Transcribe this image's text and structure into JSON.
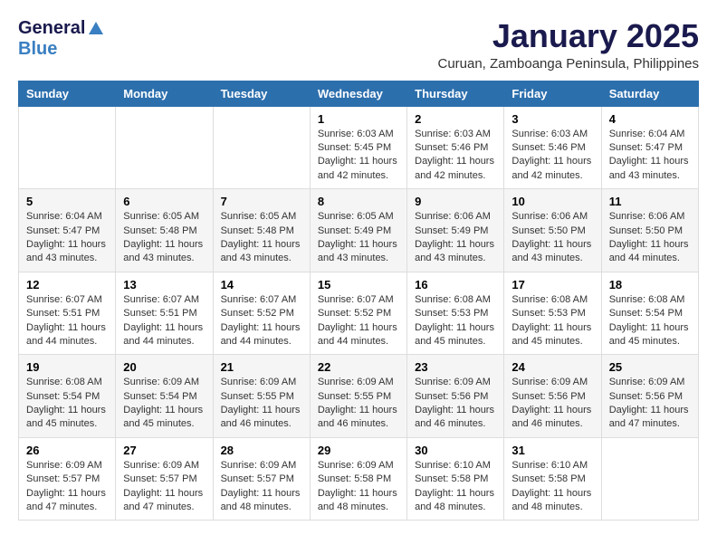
{
  "logo": {
    "general": "General",
    "blue": "Blue"
  },
  "title": "January 2025",
  "location": "Curuan, Zamboanga Peninsula, Philippines",
  "weekdays": [
    "Sunday",
    "Monday",
    "Tuesday",
    "Wednesday",
    "Thursday",
    "Friday",
    "Saturday"
  ],
  "weeks": [
    [
      {
        "day": "",
        "info": ""
      },
      {
        "day": "",
        "info": ""
      },
      {
        "day": "",
        "info": ""
      },
      {
        "day": "1",
        "info": "Sunrise: 6:03 AM\nSunset: 5:45 PM\nDaylight: 11 hours and 42 minutes."
      },
      {
        "day": "2",
        "info": "Sunrise: 6:03 AM\nSunset: 5:46 PM\nDaylight: 11 hours and 42 minutes."
      },
      {
        "day": "3",
        "info": "Sunrise: 6:03 AM\nSunset: 5:46 PM\nDaylight: 11 hours and 42 minutes."
      },
      {
        "day": "4",
        "info": "Sunrise: 6:04 AM\nSunset: 5:47 PM\nDaylight: 11 hours and 43 minutes."
      }
    ],
    [
      {
        "day": "5",
        "info": "Sunrise: 6:04 AM\nSunset: 5:47 PM\nDaylight: 11 hours and 43 minutes."
      },
      {
        "day": "6",
        "info": "Sunrise: 6:05 AM\nSunset: 5:48 PM\nDaylight: 11 hours and 43 minutes."
      },
      {
        "day": "7",
        "info": "Sunrise: 6:05 AM\nSunset: 5:48 PM\nDaylight: 11 hours and 43 minutes."
      },
      {
        "day": "8",
        "info": "Sunrise: 6:05 AM\nSunset: 5:49 PM\nDaylight: 11 hours and 43 minutes."
      },
      {
        "day": "9",
        "info": "Sunrise: 6:06 AM\nSunset: 5:49 PM\nDaylight: 11 hours and 43 minutes."
      },
      {
        "day": "10",
        "info": "Sunrise: 6:06 AM\nSunset: 5:50 PM\nDaylight: 11 hours and 43 minutes."
      },
      {
        "day": "11",
        "info": "Sunrise: 6:06 AM\nSunset: 5:50 PM\nDaylight: 11 hours and 44 minutes."
      }
    ],
    [
      {
        "day": "12",
        "info": "Sunrise: 6:07 AM\nSunset: 5:51 PM\nDaylight: 11 hours and 44 minutes."
      },
      {
        "day": "13",
        "info": "Sunrise: 6:07 AM\nSunset: 5:51 PM\nDaylight: 11 hours and 44 minutes."
      },
      {
        "day": "14",
        "info": "Sunrise: 6:07 AM\nSunset: 5:52 PM\nDaylight: 11 hours and 44 minutes."
      },
      {
        "day": "15",
        "info": "Sunrise: 6:07 AM\nSunset: 5:52 PM\nDaylight: 11 hours and 44 minutes."
      },
      {
        "day": "16",
        "info": "Sunrise: 6:08 AM\nSunset: 5:53 PM\nDaylight: 11 hours and 45 minutes."
      },
      {
        "day": "17",
        "info": "Sunrise: 6:08 AM\nSunset: 5:53 PM\nDaylight: 11 hours and 45 minutes."
      },
      {
        "day": "18",
        "info": "Sunrise: 6:08 AM\nSunset: 5:54 PM\nDaylight: 11 hours and 45 minutes."
      }
    ],
    [
      {
        "day": "19",
        "info": "Sunrise: 6:08 AM\nSunset: 5:54 PM\nDaylight: 11 hours and 45 minutes."
      },
      {
        "day": "20",
        "info": "Sunrise: 6:09 AM\nSunset: 5:54 PM\nDaylight: 11 hours and 45 minutes."
      },
      {
        "day": "21",
        "info": "Sunrise: 6:09 AM\nSunset: 5:55 PM\nDaylight: 11 hours and 46 minutes."
      },
      {
        "day": "22",
        "info": "Sunrise: 6:09 AM\nSunset: 5:55 PM\nDaylight: 11 hours and 46 minutes."
      },
      {
        "day": "23",
        "info": "Sunrise: 6:09 AM\nSunset: 5:56 PM\nDaylight: 11 hours and 46 minutes."
      },
      {
        "day": "24",
        "info": "Sunrise: 6:09 AM\nSunset: 5:56 PM\nDaylight: 11 hours and 46 minutes."
      },
      {
        "day": "25",
        "info": "Sunrise: 6:09 AM\nSunset: 5:56 PM\nDaylight: 11 hours and 47 minutes."
      }
    ],
    [
      {
        "day": "26",
        "info": "Sunrise: 6:09 AM\nSunset: 5:57 PM\nDaylight: 11 hours and 47 minutes."
      },
      {
        "day": "27",
        "info": "Sunrise: 6:09 AM\nSunset: 5:57 PM\nDaylight: 11 hours and 47 minutes."
      },
      {
        "day": "28",
        "info": "Sunrise: 6:09 AM\nSunset: 5:57 PM\nDaylight: 11 hours and 48 minutes."
      },
      {
        "day": "29",
        "info": "Sunrise: 6:09 AM\nSunset: 5:58 PM\nDaylight: 11 hours and 48 minutes."
      },
      {
        "day": "30",
        "info": "Sunrise: 6:10 AM\nSunset: 5:58 PM\nDaylight: 11 hours and 48 minutes."
      },
      {
        "day": "31",
        "info": "Sunrise: 6:10 AM\nSunset: 5:58 PM\nDaylight: 11 hours and 48 minutes."
      },
      {
        "day": "",
        "info": ""
      }
    ]
  ]
}
